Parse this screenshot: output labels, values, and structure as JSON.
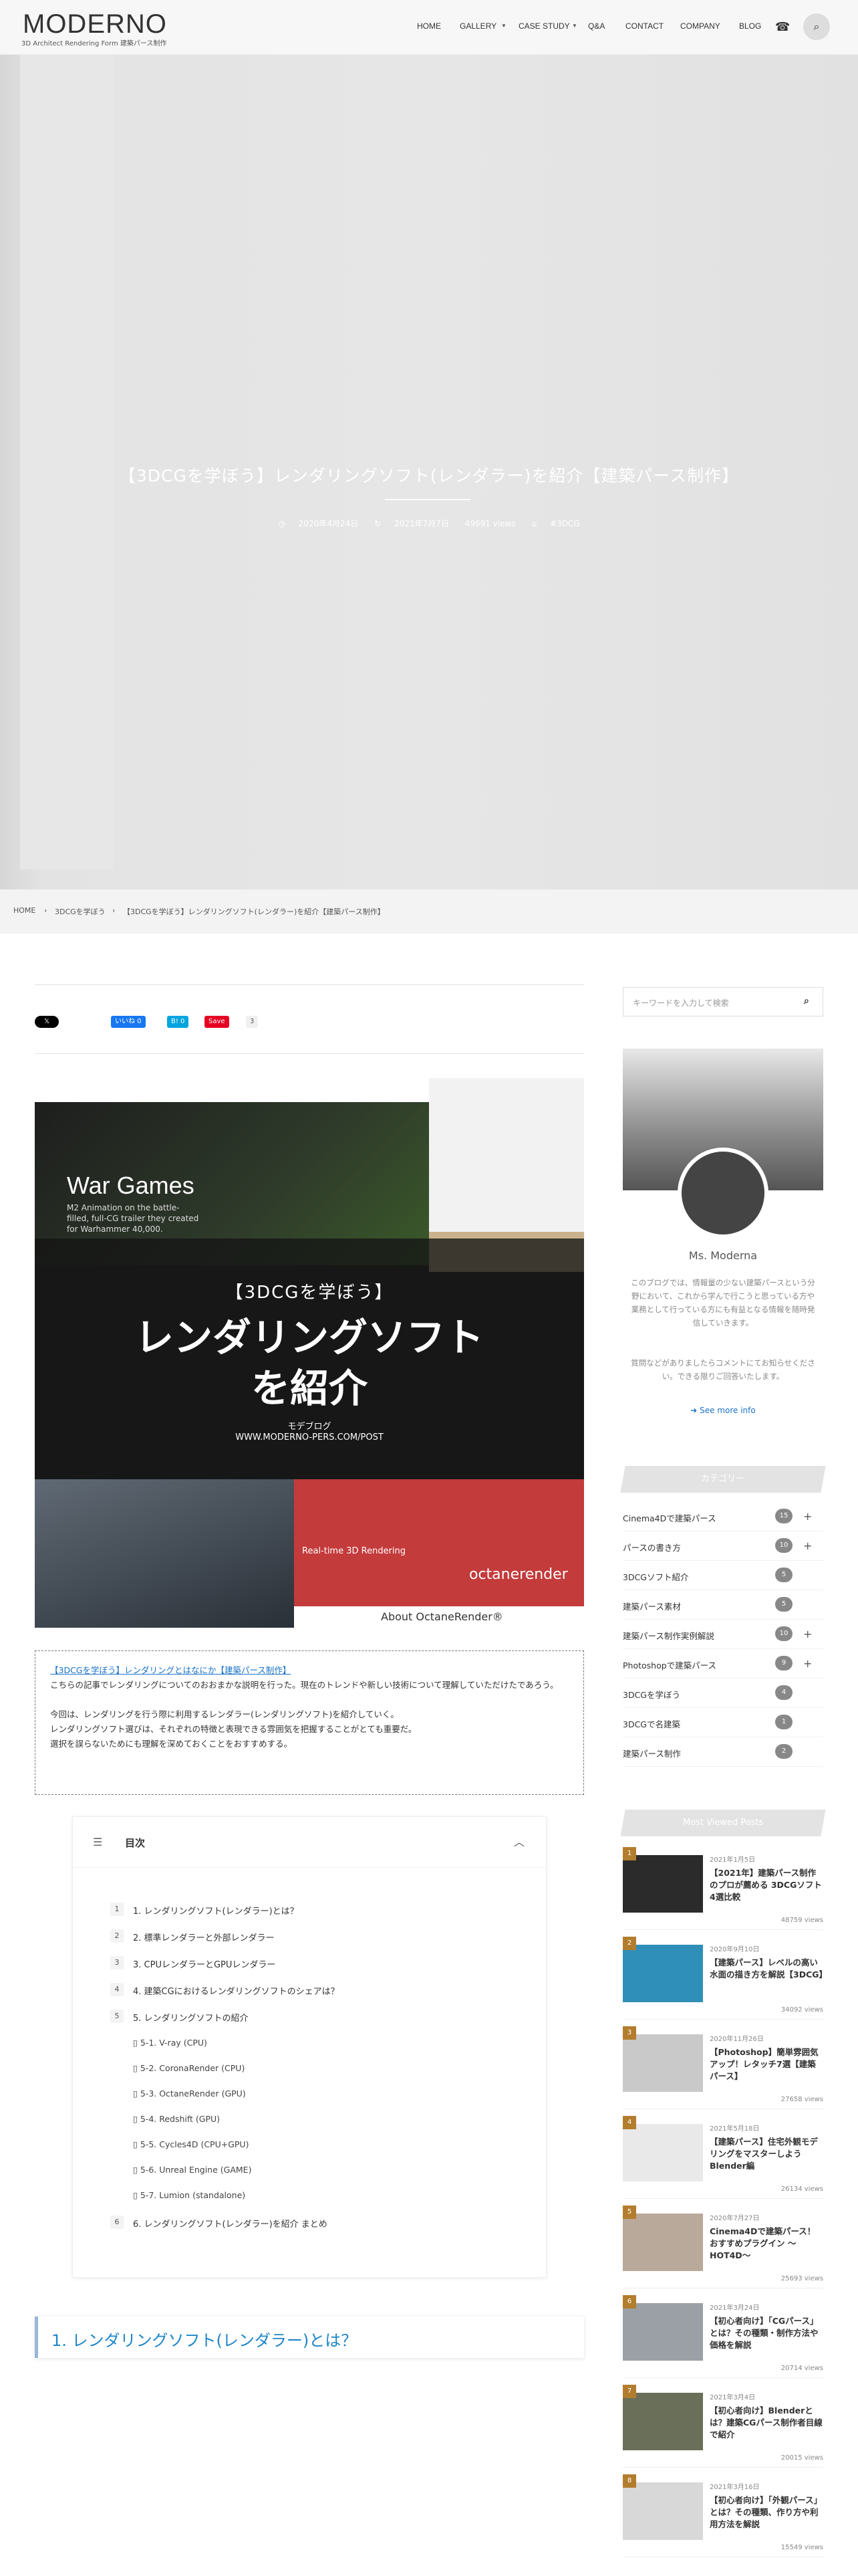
{
  "header": {
    "logo": "MODERNO",
    "logo_sub": "3D Architect Rendering Form 建築パース制作",
    "nav": [
      "HOME",
      "GALLERY",
      "CASE STUDY",
      "Q&A",
      "CONTACT",
      "COMPANY",
      "BLOG"
    ]
  },
  "hero": {
    "title": "【3DCGを学ぼう】レンダリングソフト(レンダラー)を紹介【建築パース制作】",
    "date_posted": "2020年4月24日",
    "date_updated": "2021年7月7日",
    "views": "49691 views",
    "tag": "#3DCG"
  },
  "breadcrumb": {
    "home": "HOME",
    "category": "3DCGを学ぼう",
    "current": "【3DCGを学ぼう】レンダリングソフト(レンダラー)を紹介【建築パース制作】"
  },
  "share": {
    "x": "𝕏",
    "like": "いいね 0",
    "hatena": "B! 0",
    "save": "Save",
    "save_count": "3"
  },
  "eyecatch": {
    "kicker": "【3DCGを学ぼう】",
    "title_line1": "レンダリングソフト",
    "title_line2": "を紹介",
    "blog": "モデブログ",
    "url": "WWW.MODERNO-PERS.COM/POST",
    "wargames": "War Games",
    "wargames_sub": "M2 Animation on the battle-filled, full-CG trailer they created for Warhammer 40,000.",
    "realtime": "Real-time 3D Rendering",
    "octane": "octanerender",
    "about": "About OctaneRender®"
  },
  "intro": {
    "link": "【3DCGを学ぼう】レンダリングとはなにか【建築パース制作】",
    "p1": "こちらの記事でレンダリングについてのおおまかな説明を行った。現在のトレンドや新しい技術について理解していただけたであろう。",
    "p2": "今回は、レンダリングを行う際に利用するレンダラー(レンダリングソフト)を紹介していく。",
    "p3": "レンダリングソフト選びは、それぞれの特徴と表現できる雰囲気を把握することがとても重要だ。",
    "p4": "選択を誤らないためにも理解を深めておくことをおすすめする。"
  },
  "toc": {
    "title": "目次",
    "items": [
      {
        "num": "1",
        "label": "1. レンダリングソフト(レンダラー)とは？"
      },
      {
        "num": "2",
        "label": "2. 標準レンダラーと外部レンダラー"
      },
      {
        "num": "3",
        "label": "3. CPUレンダラーとGPUレンダラー"
      },
      {
        "num": "4",
        "label": "4. 建築CGにおけるレンダリングソフトのシェアは？"
      },
      {
        "num": "5",
        "label": "5. レンダリングソフトの紹介"
      }
    ],
    "subs": [
      "5-1. V-ray (CPU)",
      "5-2. CoronaRender (CPU)",
      "5-3. OctaneRender (GPU)",
      "5-4. Redshift (GPU)",
      "5-5. Cycles4D (CPU+GPU)",
      "5-6. Unreal Engine (GAME)",
      "5-7. Lumion (standalone)"
    ],
    "last": {
      "num": "6",
      "label": "6. レンダリングソフト(レンダラー)を紹介 まとめ"
    }
  },
  "h2": "1. レンダリングソフト(レンダラー)とは？",
  "sidebar": {
    "search_placeholder": "キーワードを入力して検索",
    "profile_name": "Ms. Moderna",
    "profile_desc": "このブログでは、情報量の少ない建築パースという分野において、これから学んで行こうと思っている方や業務として行っている方にも有益となる情報を随時発信していきます。",
    "profile_desc2": "質問などがありましたらコメントにてお知らせください。できる限りご回答いたします。",
    "see_more": "See more info",
    "category_title": "カテゴリー",
    "categories": [
      {
        "label": "Cinema4Dで建築パース",
        "count": "15",
        "plus": true
      },
      {
        "label": "パースの書き方",
        "count": "10",
        "plus": true
      },
      {
        "label": "3DCGソフト紹介",
        "count": "5",
        "plus": false
      },
      {
        "label": "建築パース素材",
        "count": "5",
        "plus": false
      },
      {
        "label": "建築パース制作実例解説",
        "count": "10",
        "plus": true
      },
      {
        "label": "Photoshopで建築パース",
        "count": "9",
        "plus": true
      },
      {
        "label": "3DCGを学ぼう",
        "count": "4",
        "plus": false
      },
      {
        "label": "3DCGで名建築",
        "count": "1",
        "plus": false
      },
      {
        "label": "建築パース制作",
        "count": "2",
        "plus": false
      }
    ],
    "popular_title": "Most Viewed Posts",
    "posts": [
      {
        "rank": "1",
        "date": "2021年1月5日",
        "title": "【2021年】建築パース制作のプロが薦める 3DCGソフト4選比較",
        "views": "48759 views"
      },
      {
        "rank": "2",
        "date": "2020年9月10日",
        "title": "【建築パース】レベルの高い水面の描き方を解説【3DCG】",
        "views": "34092 views"
      },
      {
        "rank": "3",
        "date": "2020年11月26日",
        "title": "【Photoshop】簡単雰囲気アップ！レタッチ7選【建築パース】",
        "views": "27658 views"
      },
      {
        "rank": "4",
        "date": "2021年5月18日",
        "title": "【建築パース】住宅外観モデリングをマスターしよう Blender編",
        "views": "26134 views"
      },
      {
        "rank": "5",
        "date": "2020年7月27日",
        "title": "Cinema4Dで建築パース！おすすめプラグイン 〜HOT4D〜",
        "views": "25693 views"
      },
      {
        "rank": "6",
        "date": "2021年3月24日",
        "title": "【初心者向け】「CGパース」とは？その種類・制作方法や価格を解説",
        "views": "20714 views"
      },
      {
        "rank": "7",
        "date": "2021年3月4日",
        "title": "【初心者向け】Blenderとは？建築CGパース制作者目線で紹介",
        "views": "20015 views"
      },
      {
        "rank": "8",
        "date": "2021年3月16日",
        "title": "【初心者向け】「外観パース」とは？その種類、作り方や利用方法を解説",
        "views": "15549 views"
      }
    ]
  },
  "colors": {
    "accent": "#1e86c8",
    "link": "#1a73c8",
    "badge": "#888888",
    "rank": "#b37d2e"
  }
}
